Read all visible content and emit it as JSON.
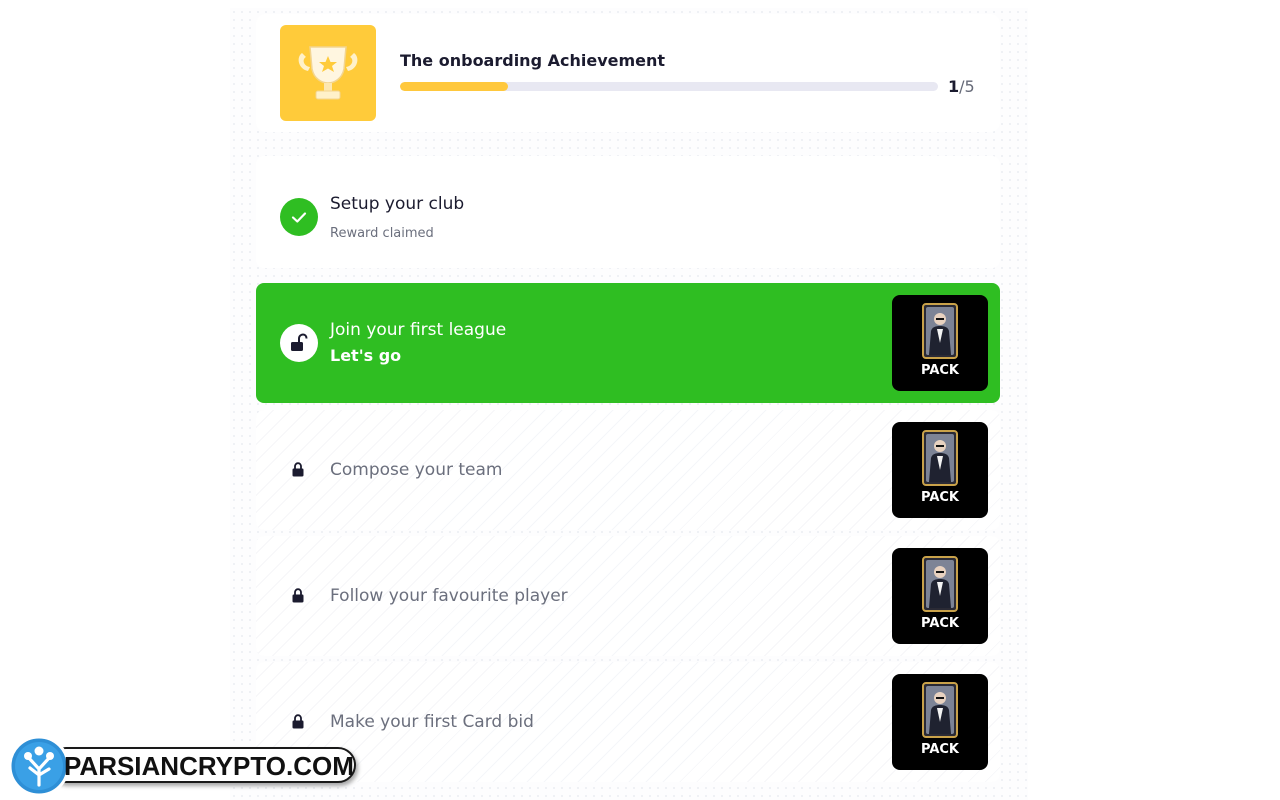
{
  "achievement": {
    "title": "The onboarding Achievement",
    "progress_current": "1",
    "progress_total": "/5",
    "progress_fraction": 0.2
  },
  "tasks": [
    {
      "title": "Setup your club",
      "subtitle": "Reward claimed",
      "state": "completed"
    },
    {
      "title": "Join your first league",
      "subtitle": "Let's go",
      "state": "active",
      "reward": "PACK"
    },
    {
      "title": "Compose your team",
      "state": "locked",
      "reward": "PACK"
    },
    {
      "title": "Follow your favourite player",
      "state": "locked",
      "reward": "PACK"
    },
    {
      "title": "Make your first Card bid",
      "state": "locked",
      "reward": "PACK"
    }
  ],
  "watermark": {
    "text": "PARSIANCRYPTO.COM"
  },
  "colors": {
    "accent_green": "#2fbe22",
    "trophy_yellow": "#ffcb3a",
    "progress_yellow": "#ffc83d",
    "pack_black": "#000000"
  },
  "icons": [
    "trophy-icon",
    "check-icon",
    "unlock-icon",
    "lock-icon",
    "card-pack-icon",
    "parsiancrypto-logo"
  ]
}
